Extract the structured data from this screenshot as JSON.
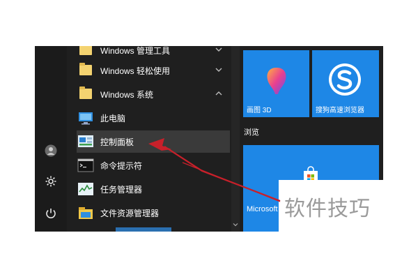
{
  "app_list": {
    "items": [
      {
        "label": "Windows 管理工具",
        "icon": "folder-icon",
        "chevron": "down"
      },
      {
        "label": "Windows 轻松使用",
        "icon": "folder-icon",
        "chevron": "down"
      },
      {
        "label": "Windows 系统",
        "icon": "folder-icon",
        "chevron": "up"
      },
      {
        "label": "此电脑",
        "icon": "computer-icon"
      },
      {
        "label": "控制面板",
        "icon": "control-panel-icon",
        "selected": true
      },
      {
        "label": "命令提示符",
        "icon": "command-prompt-icon"
      },
      {
        "label": "任务管理器",
        "icon": "task-manager-icon"
      },
      {
        "label": "文件资源管理器",
        "icon": "file-explorer-icon"
      }
    ]
  },
  "left_rail": {
    "icons": [
      "user-icon",
      "settings-gear-icon",
      "power-icon"
    ]
  },
  "tiles": {
    "paint3d_label": "画图 3D",
    "browser_label": "搜狗高速浏览器",
    "group_heading": "浏览",
    "store_label": "Microsoft"
  },
  "watermark": "软件技巧",
  "colors": {
    "tile_blue": "#1e87e6",
    "menu_bg": "#1f1f1f",
    "selected_bg": "#3a3a3a",
    "arrow_red": "#c8202a"
  }
}
